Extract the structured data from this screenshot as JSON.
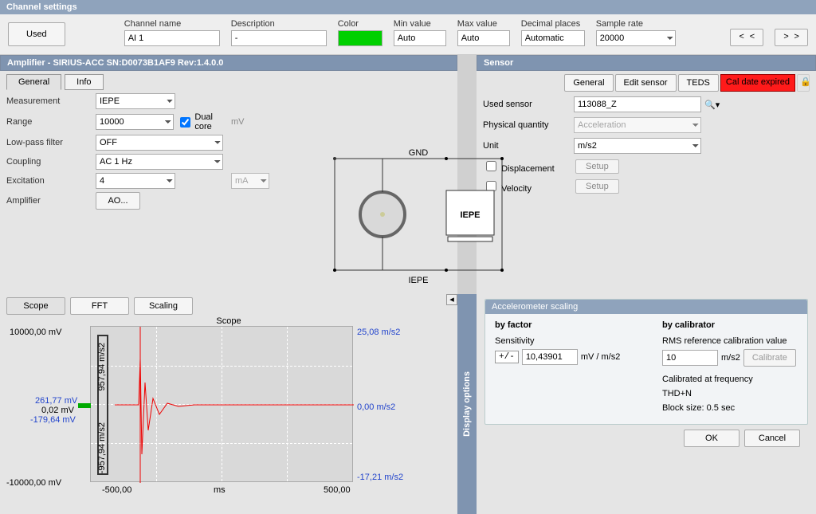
{
  "title": "Channel settings",
  "top": {
    "used_btn": "Used",
    "channel_name_lbl": "Channel name",
    "channel_name": "AI 1",
    "description_lbl": "Description",
    "description": "-",
    "color_lbl": "Color",
    "color": "#00d000",
    "min_lbl": "Min value",
    "min": "Auto",
    "max_lbl": "Max value",
    "max": "Auto",
    "dec_lbl": "Decimal places",
    "dec": "Automatic",
    "sr_lbl": "Sample rate",
    "sr": "20000",
    "prev": "< <",
    "next": "> >"
  },
  "amp": {
    "title": "Amplifier - SIRIUS-ACC  SN:D0073B1AF9 Rev:1.4.0.0",
    "tab_general": "General",
    "tab_info": "Info",
    "measurement_lbl": "Measurement",
    "measurement": "IEPE",
    "range_lbl": "Range",
    "range": "10000",
    "dualcore": "Dual core",
    "dualcore_unit": "mV",
    "lpf_lbl": "Low-pass filter",
    "lpf": "OFF",
    "coupling_lbl": "Coupling",
    "coupling": "AC  1 Hz",
    "excitation_lbl": "Excitation",
    "excitation": "4",
    "excitation_unit": "mA",
    "amplifier_lbl": "Amplifier",
    "amplifier_btn": "AO..."
  },
  "circuit": {
    "top": "GND",
    "bottom": "IEPE",
    "box": "IEPE"
  },
  "sensor": {
    "title": "Sensor",
    "general": "General",
    "edit": "Edit sensor",
    "teds": "TEDS",
    "cal": "Cal date expired",
    "used_lbl": "Used sensor",
    "used": "113088_Z",
    "pq_lbl": "Physical quantity",
    "pq": "Acceleration",
    "unit_lbl": "Unit",
    "unit": "m/s2",
    "disp": "Displacement",
    "vel": "Velocity",
    "setup": "Setup"
  },
  "scope": {
    "tab_scope": "Scope",
    "tab_fft": "FFT",
    "tab_scaling": "Scaling",
    "title": "Scope",
    "y_top": "10000,00 mV",
    "y_bot": "-10000,00 mV",
    "ry_top": "25,08 m/s2",
    "ry_mid": "0,00 m/s2",
    "ry_bot": "-17,21 m/s2",
    "cursor_top": "261,77 mV",
    "cursor_mid": "0,02 mV",
    "cursor_bot": "-179,64 mV",
    "vbar_top": "957,94 m/s2",
    "vbar_bot": "-957,94 m/s2",
    "x_left": "-500,00",
    "x_label": "ms",
    "x_right": "500,00",
    "disp_options": "Display options"
  },
  "acc": {
    "title": "Accelerometer scaling",
    "byf": "by factor",
    "byc": "by calibrator",
    "sens_lbl": "Sensitivity",
    "sens": "10,43901",
    "sens_unit": "mV / m/s2",
    "tgl": "+/-",
    "rms_lbl": "RMS reference calibration value",
    "rms": "10",
    "rms_unit": "m/s2",
    "calibrate": "Calibrate",
    "calfreq": "Calibrated at frequency",
    "thd": "THD+N",
    "block": "Block size: 0.5 sec"
  },
  "footer": {
    "ok": "OK",
    "cancel": "Cancel"
  },
  "chart_data": {
    "type": "line",
    "title": "Scope",
    "xlabel": "ms",
    "xlim": [
      -500,
      500
    ],
    "y_left": {
      "label": "mV",
      "lim": [
        -10000,
        10000
      ]
    },
    "y_right": {
      "label": "m/s2",
      "lim": [
        -25.08,
        25.08
      ]
    },
    "cursors_mv": [
      261.77,
      0.02,
      -179.64
    ],
    "vbar_ms2": [
      957.94,
      -957.94
    ],
    "trace_note": "impulse-like transient centred near -310 ms decaying to ~0 mV"
  }
}
